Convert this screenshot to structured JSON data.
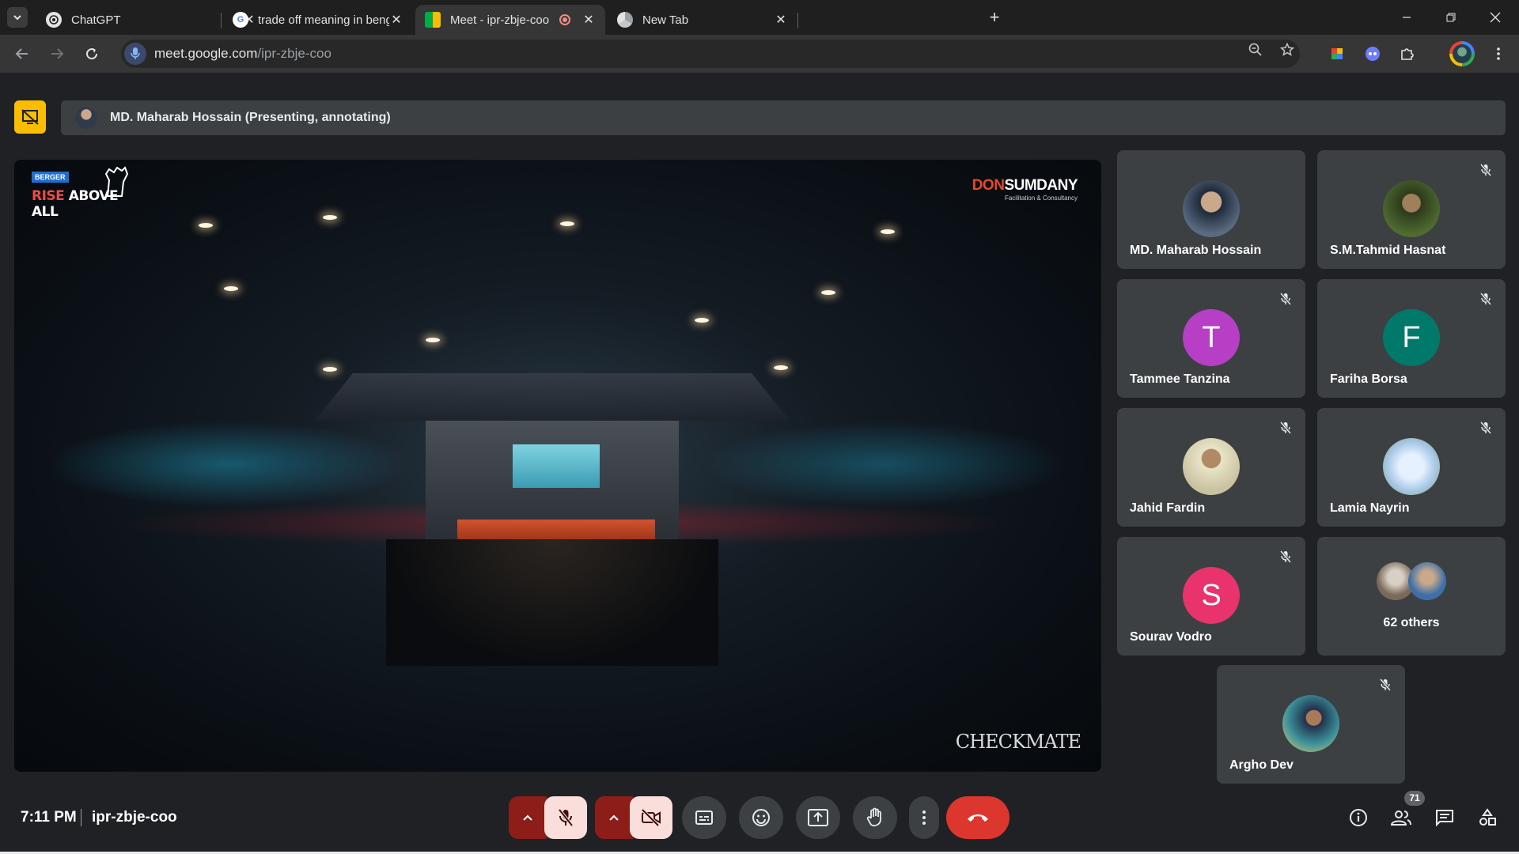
{
  "browser": {
    "tabs": [
      {
        "title": "ChatGPT",
        "favicon": "chatgpt-icon"
      },
      {
        "title": "trade off meaning in bengali - G",
        "favicon": "google-icon"
      },
      {
        "title": "Meet - ipr-zbje-coo",
        "favicon": "meet-icon",
        "recording": true
      },
      {
        "title": "New Tab",
        "favicon": "chrome-icon"
      }
    ],
    "address": {
      "domain": "meet.google.com",
      "path": "/ipr-zbje-coo"
    }
  },
  "presenter": {
    "label": "MD. Maharab Hossain (Presenting, annotating)"
  },
  "shared_screen": {
    "logo_left": {
      "badge": "BERGER",
      "title_part1": "RISE",
      "title_part2": " ABOVE ALL"
    },
    "logo_right": {
      "title_part1": "DON",
      "title_part2": "SUMDANY",
      "subtitle": "Facilitation & Consultancy"
    },
    "watermark": "CHECKMATE"
  },
  "participants": [
    {
      "name": "MD. Maharab Hossain",
      "muted": false,
      "avatar": "photo",
      "color": "#5a6a80"
    },
    {
      "name": "S.M.Tahmid Hasnat",
      "muted": true,
      "avatar": "photo",
      "color": "#4f6b2f"
    },
    {
      "name": "Tammee Tanzina",
      "muted": true,
      "avatar": "letter",
      "letter": "T",
      "color": "#b63fc6"
    },
    {
      "name": "Fariha Borsa",
      "muted": true,
      "avatar": "letter",
      "letter": "F",
      "color": "#00796b"
    },
    {
      "name": "Jahid Fardin",
      "muted": true,
      "avatar": "photo",
      "color": "#c9c2a0"
    },
    {
      "name": "Lamia Nayrin",
      "muted": true,
      "avatar": "photo",
      "color": "#a8c8e8"
    },
    {
      "name": "Sourav Vodro",
      "muted": true,
      "avatar": "letter",
      "letter": "S",
      "color": "#e8336c"
    },
    {
      "name": "Argho Dev",
      "muted": true,
      "avatar": "photo",
      "color": "#3a8f9a"
    }
  ],
  "others": {
    "label": "62 others"
  },
  "footer": {
    "time": "7:11 PM",
    "meeting_code": "ipr-zbje-coo",
    "people_count": "71"
  },
  "colors": {
    "leave": "#dc362e",
    "present_stop": "#fbbc04",
    "tile_bg": "#3c4043",
    "page_bg": "#202124"
  }
}
